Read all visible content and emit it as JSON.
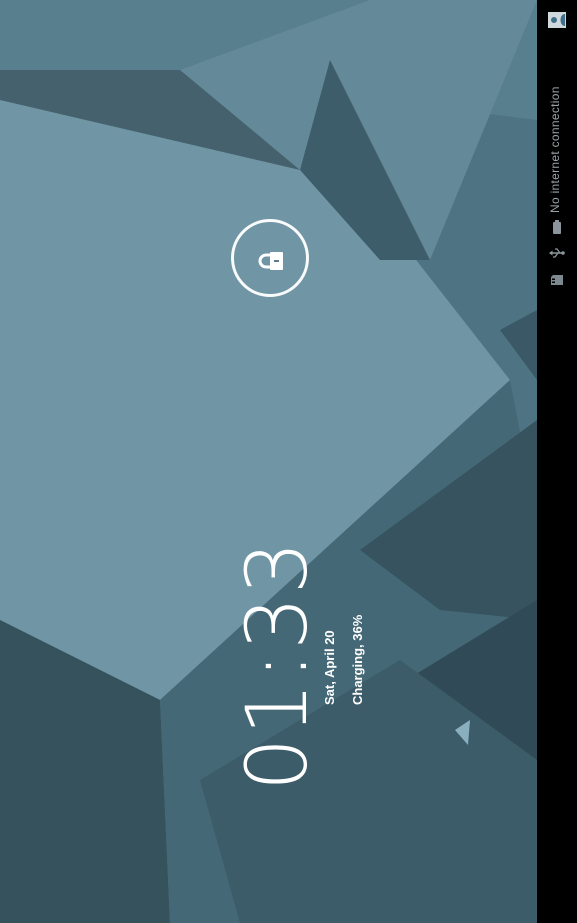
{
  "lockscreen": {
    "time": "01:33",
    "date": "Sat, April 20",
    "charging": "Charging, 36%"
  },
  "status_bar": {
    "connection_text": "No internet connection",
    "icons": [
      "sd-card-icon",
      "usb-icon",
      "battery-icon",
      "account-icon"
    ]
  },
  "colors": {
    "background": "#4f7180",
    "status_bar": "#000000",
    "text": "#ffffff"
  }
}
